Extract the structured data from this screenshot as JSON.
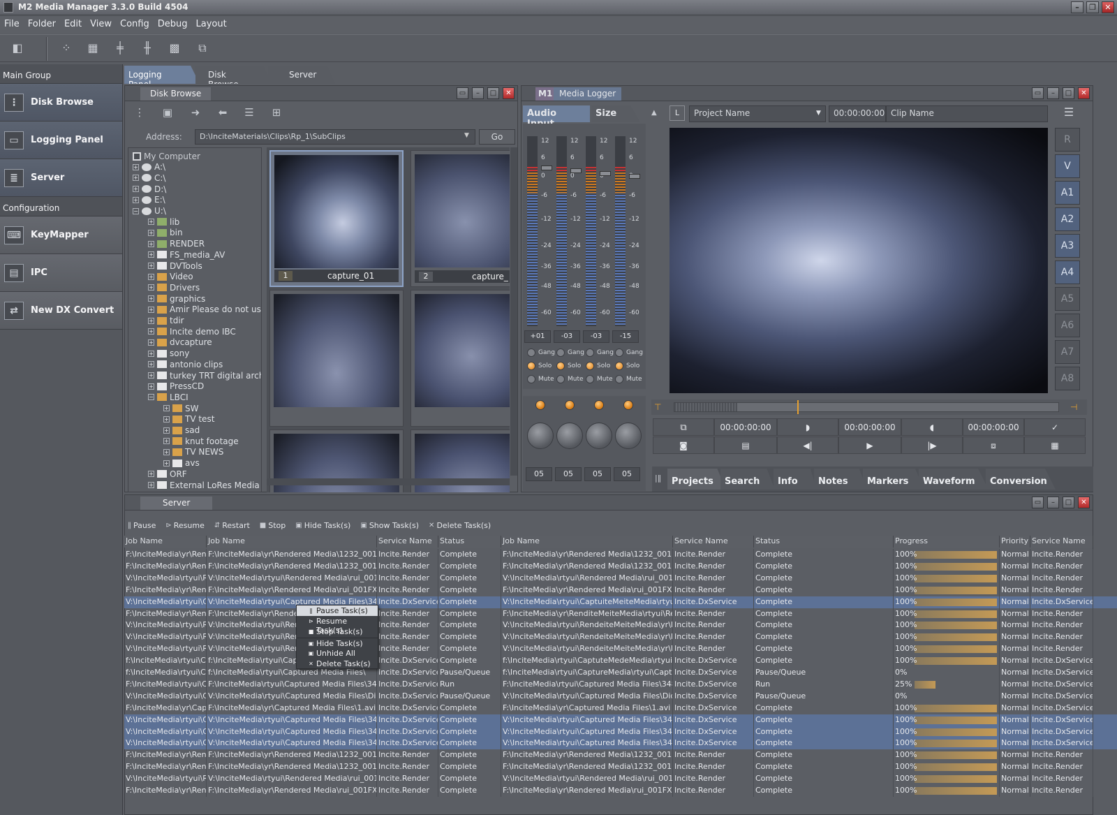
{
  "app": {
    "title": "M2 Media Manager 3.3.0 Build 4504"
  },
  "menu": [
    "File",
    "Folder",
    "Edit",
    "View",
    "Config",
    "Debug",
    "Layout"
  ],
  "sidebar": {
    "group1": "Main Group",
    "items1": [
      "Disk Browse",
      "Logging Panel",
      "Server"
    ],
    "group2": "Configuration",
    "items2": [
      "KeyMapper",
      "IPC",
      "New DX Convert"
    ]
  },
  "tabs": [
    "Logging Panel",
    "Disk Browse",
    "Server"
  ],
  "disk_browse": {
    "title": "Disk Browse",
    "address_label": "Address:",
    "address_value": "D:\\InciteMaterials\\Clips\\Rp_1\\SubClips",
    "go": "Go",
    "tree": [
      {
        "d": 0,
        "label": "My Computer"
      },
      {
        "d": 1,
        "label": "A:\\"
      },
      {
        "d": 1,
        "label": "C:\\"
      },
      {
        "d": 1,
        "label": "D:\\"
      },
      {
        "d": 1,
        "label": "E:\\"
      },
      {
        "d": 1,
        "label": "U:\\"
      },
      {
        "d": 2,
        "label": "lib"
      },
      {
        "d": 2,
        "label": "bin"
      },
      {
        "d": 2,
        "label": "RENDER"
      },
      {
        "d": 2,
        "label": "FS_media_AV"
      },
      {
        "d": 2,
        "label": "DVTools"
      },
      {
        "d": 2,
        "label": "Video"
      },
      {
        "d": 2,
        "label": "Drivers"
      },
      {
        "d": 2,
        "label": "graphics"
      },
      {
        "d": 2,
        "label": "Amir Please do not use"
      },
      {
        "d": 2,
        "label": "tdir"
      },
      {
        "d": 2,
        "label": "Incite demo IBC"
      },
      {
        "d": 2,
        "label": "dvcapture"
      },
      {
        "d": 2,
        "label": "sony"
      },
      {
        "d": 2,
        "label": "antonio clips"
      },
      {
        "d": 2,
        "label": "turkey TRT digital archive"
      },
      {
        "d": 2,
        "label": "PressCD"
      },
      {
        "d": 2,
        "label": "LBCI"
      },
      {
        "d": 3,
        "label": "SW"
      },
      {
        "d": 3,
        "label": "TV test"
      },
      {
        "d": 3,
        "label": "sad"
      },
      {
        "d": 3,
        "label": "knut footage"
      },
      {
        "d": 3,
        "label": "TV NEWS"
      },
      {
        "d": 3,
        "label": "avs"
      },
      {
        "d": 2,
        "label": "ORF"
      },
      {
        "d": 2,
        "label": "External LoRes Media"
      }
    ],
    "thumbs": [
      {
        "num": "1",
        "name": "capture_01"
      },
      {
        "num": "2",
        "name": "capture_"
      }
    ]
  },
  "logger": {
    "badge": "M1",
    "title": "Media Logger",
    "tab_audio": "Audio Input",
    "tab_size": "Size",
    "project": "Project Name",
    "timecode": "00:00:00:00",
    "clip": "Clip Name",
    "scale": [
      "12",
      "6",
      "0",
      "-6",
      "-12",
      "-24",
      "-36",
      "-48",
      "-60"
    ],
    "levels": [
      "+01",
      "-03",
      "-03",
      "-15"
    ],
    "gang": "Gang",
    "solo": "Solo",
    "mute": "Mute",
    "pans": [
      "05",
      "05",
      "05",
      "05"
    ],
    "tracks": [
      "R",
      "V",
      "A1",
      "A2",
      "A3",
      "A4",
      "A5",
      "A6",
      "A7",
      "A8"
    ],
    "tc_in": "00:00:00:00",
    "tc_mid": "00:00:00:00",
    "tc_out": "00:00:00:00",
    "bottom_tabs": [
      "Projects",
      "Search",
      "Info",
      "Notes",
      "Markers",
      "Waveform",
      "Conversion"
    ]
  },
  "server": {
    "title": "Server",
    "actions": [
      "Pause",
      "Resume",
      "Restart",
      "Stop",
      "Hide Task(s)",
      "Show Task(s)",
      "Delete Task(s)"
    ],
    "headers": [
      "Job Name",
      "Job Name",
      "Service Name",
      "Status",
      "Job Name",
      "Service Name",
      "Status",
      "Progress",
      "Priority",
      "Service Name"
    ],
    "rows": [
      [
        "F:\\InciteMedia\\yr\\Rende",
        "F:\\InciteMedia\\yr\\Rendered Media\\1232_001FX.avi",
        "Incite.Render",
        "Complete",
        "F:\\InciteMedia\\yr\\Rendered Media\\1232_001FX.avi",
        "Incite.Render",
        "Complete",
        "100%",
        "Normal",
        "Incite.Render",
        0
      ],
      [
        "F:\\InciteMedia\\yr\\Rende",
        "F:\\InciteMedia\\yr\\Rendered Media\\1232_001FX.avi",
        "Incite.Render",
        "Complete",
        "F:\\InciteMedia\\yr\\Rendered Media\\1232_001FX.avi",
        "Incite.Render",
        "Complete",
        "100%",
        "Normal",
        "Incite.Render",
        0
      ],
      [
        "V:\\InciteMedia\\rtyui\\Ren",
        "V:\\InciteMedia\\rtyui\\Rendered Media\\rui_001FX.avi",
        "Incite.Render",
        "Complete",
        "V:\\InciteMedia\\rtyui\\Rendered Media\\rui_001FX.avi",
        "Incite.Render",
        "Complete",
        "100%",
        "Normal",
        "Incite.Render",
        0
      ],
      [
        "F:\\InciteMedia\\yr\\Rende",
        "F:\\InciteMedia\\yr\\Rendered Media\\rui_001FX.avi",
        "Incite.Render",
        "Complete",
        "F:\\InciteMedia\\yr\\Rendered Media\\rui_001FX.avi",
        "Incite.Render",
        "Complete",
        "100%",
        "Normal",
        "Incite.Render",
        0
      ],
      [
        "V:\\InciteMedia\\rtyui\\Cap",
        "V:\\InciteMedia\\rtyui\\Captured Media Files\\348_02",
        "Incite.DxService",
        "Complete",
        "V:\\InciteMedia\\rtyui\\CaptuiteMeiteMedia\\rtyui\\Capt",
        "Incite.DxService",
        "Complete",
        "100%",
        "Normal",
        "Incite.DxService",
        1
      ],
      [
        "F:\\InciteMedia\\yr\\Rende",
        "F:\\InciteMedia\\yr\\Rende",
        "Incite.Render",
        "Complete",
        "F:\\InciteMedia\\yr\\RenditeMeiteMedia\\rtyui\\Rend",
        "Incite.Render",
        "Complete",
        "100%",
        "Normal",
        "Incite.Render",
        0
      ],
      [
        "V:\\InciteMedia\\rtyui\\Rend",
        "V:\\InciteMedia\\rtyui\\Rende",
        "Incite.Render",
        "Complete",
        "V:\\InciteMedia\\rtyui\\RendeiteMeiteMedia\\yr\\Render",
        "Incite.Render",
        "Complete",
        "100%",
        "Normal",
        "Incite.Render",
        0
      ],
      [
        "V:\\InciteMedia\\rtyui\\Rend",
        "V:\\InciteMedia\\rtyui\\Rende",
        "Incite.Render",
        "Complete",
        "V:\\InciteMedia\\rtyui\\RendeiteMeiteMedia\\yr\\Render",
        "Incite.Render",
        "Complete",
        "100%",
        "Normal",
        "Incite.Render",
        0
      ],
      [
        "V:\\InciteMedia\\rtyui\\Rend",
        "V:\\InciteMedia\\rtyui\\Rende",
        "Incite.Render",
        "Complete",
        "V:\\InciteMedia\\rtyui\\RendeiteMeiteMedia\\yr\\Render",
        "Incite.Render",
        "Complete",
        "100%",
        "Normal",
        "Incite.Render",
        0
      ],
      [
        "f:\\InciteMedia\\rtyui\\Capt",
        "f:\\InciteMedia\\rtyui\\Captur",
        "Incite.DxService",
        "Complete",
        "f:\\InciteMedia\\rtyui\\CaptuteMedeMedia\\rtyui\\Captu",
        "Incite.DxService",
        "Complete",
        "100%",
        "Normal",
        "Incite.DxService",
        0
      ],
      [
        "f:\\InciteMedia\\rtyui\\Capt",
        "f:\\InciteMedia\\rtyui\\Captured Media Files\\",
        "Incite.DxService",
        "Pause/Queue",
        "f:\\InciteMedia\\rtyui\\CaptureMedia\\rtyui\\Captu",
        "Incite.DxService",
        "Pause/Queue",
        "0%",
        "Normal",
        "Incite.DxService",
        0
      ],
      [
        "F:\\InciteMedia\\rtyui\\Cap",
        "F:\\InciteMedia\\rtyui\\Captured Media Files\\348.avi",
        "Incite.DxService",
        "Run",
        "F:\\InciteMedia\\rtyui\\Captured Media Files\\348.avi",
        "Incite.DxService",
        "Run",
        "25%",
        "Normal",
        "Incite.DxService",
        0
      ],
      [
        "V:\\InciteMedia\\rtyui\\Cap",
        "V:\\InciteMedia\\rtyui\\Captured Media Files\\Didiermp",
        "Incite.DxService",
        "Pause/Queue",
        "V:\\InciteMedia\\rtyui\\Captured Media Files\\Didiermp",
        "Incite.DxService",
        "Pause/Queue",
        "0%",
        "Normal",
        "Incite.DxService",
        0
      ],
      [
        "F:\\InciteMedia\\yr\\Captu",
        "F:\\InciteMedia\\yr\\Captured Media Files\\1.avi",
        "Incite.DxService",
        "Complete",
        "F:\\InciteMedia\\yr\\Captured Media Files\\1.avi",
        "Incite.DxService",
        "Complete",
        "100%",
        "Normal",
        "Incite.DxService",
        0
      ],
      [
        "V:\\InciteMedia\\rtyui\\Cap",
        "V:\\InciteMedia\\rtyui\\Captured Media Files\\348_01",
        "Incite.DxService",
        "Complete",
        "V:\\InciteMedia\\rtyui\\Captured Media Files\\348_01",
        "Incite.DxService",
        "Complete",
        "100%",
        "Normal",
        "Incite.DxService",
        1
      ],
      [
        "V:\\InciteMedia\\rtyui\\Cap",
        "V:\\InciteMedia\\rtyui\\Captured Media Files\\348_03",
        "Incite.DxService",
        "Complete",
        "V:\\InciteMedia\\rtyui\\Captured Media Files\\348_03",
        "Incite.DxService",
        "Complete",
        "100%",
        "Normal",
        "Incite.DxService",
        1
      ],
      [
        "V:\\InciteMedia\\rtyui\\Cap",
        "V:\\InciteMedia\\rtyui\\Captured Media Files\\348_08",
        "Incite.DxService",
        "Complete",
        "V:\\InciteMedia\\rtyui\\Captured Media Files\\348_08",
        "Incite.DxService",
        "Complete",
        "100%",
        "Normal",
        "Incite.DxService",
        1
      ],
      [
        "F:\\InciteMedia\\yr\\Rende",
        "F:\\InciteMedia\\yr\\Rendered Media\\1232_001FX.avi",
        "Incite.Render",
        "Complete",
        "F:\\InciteMedia\\yr\\Rendered Media\\1232_001FX.avi",
        "Incite.Render",
        "Complete",
        "100%",
        "Normal",
        "Incite.Render",
        0
      ],
      [
        "F:\\InciteMedia\\yr\\Rende",
        "F:\\InciteMedia\\yr\\Rendered Media\\1232_001FX.avi",
        "Incite.Render",
        "Complete",
        "F:\\InciteMedia\\yr\\Rendered Media\\1232_001FX.avi",
        "Incite.Render",
        "Complete",
        "100%",
        "Normal",
        "Incite.Render",
        0
      ],
      [
        "V:\\InciteMedia\\rtyui\\Ren",
        "V:\\InciteMedia\\rtyui\\Rendered Media\\rui_001FX.avi",
        "Incite.Render",
        "Complete",
        "V:\\InciteMedia\\rtyui\\Rendered Media\\rui_001FX.avi",
        "Incite.Render",
        "Complete",
        "100%",
        "Normal",
        "Incite.Render",
        0
      ],
      [
        "F:\\InciteMedia\\yr\\Rende",
        "F:\\InciteMedia\\yr\\Rendered Media\\rui_001FX.avi",
        "Incite.Render",
        "Complete",
        "F:\\InciteMedia\\yr\\Rendered Media\\rui_001FX.avi",
        "Incite.Render",
        "Complete",
        "100%",
        "Normal",
        "Incite.Render",
        0
      ]
    ],
    "context_menu": [
      "Pause Task(s)",
      "Resume Task(s)",
      "Stop Task(s)",
      "Hide Task(s)",
      "Unhide All",
      "Delete Task(s)"
    ]
  },
  "colors": {
    "accent": "#6d7f9b",
    "selection": "#5c7196",
    "orange": "#dd7c12"
  }
}
